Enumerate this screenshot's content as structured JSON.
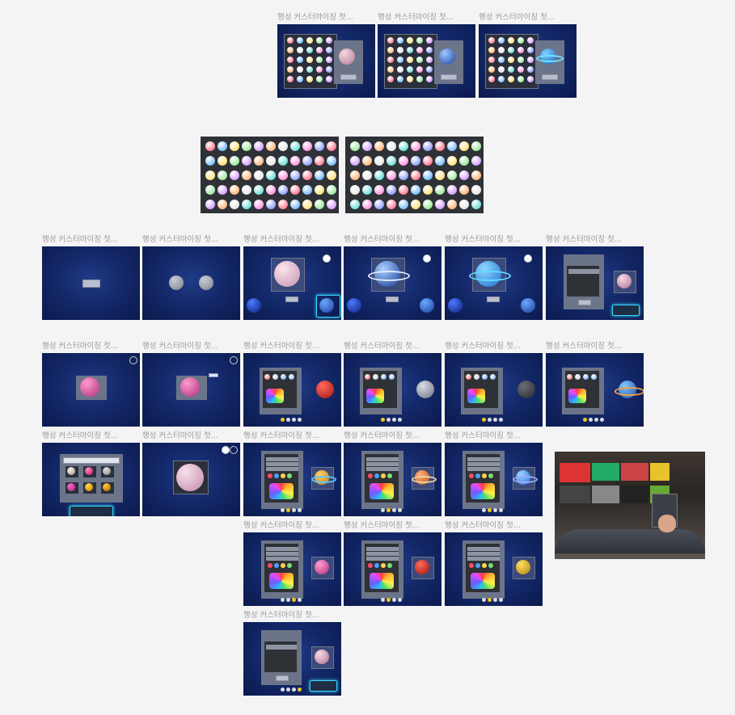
{
  "frame_title": "행성 커스터마이징 첫...",
  "frames": [
    {
      "id": "r1-1",
      "title": "행성 커스터마이징 첫..."
    },
    {
      "id": "r1-2",
      "title": "행성 커스터마이징 첫..."
    },
    {
      "id": "r1-3",
      "title": "행성 커스터마이징 첫..."
    },
    {
      "id": "r3-1",
      "title": "행성 커스터마이징 첫..."
    },
    {
      "id": "r3-2",
      "title": "행성 커스터마이징 첫..."
    },
    {
      "id": "r3-3",
      "title": "행성 커스터마이징 첫..."
    },
    {
      "id": "r3-4",
      "title": "행성 커스터마이징 첫..."
    },
    {
      "id": "r3-5",
      "title": "행성 커스터마이징 첫..."
    },
    {
      "id": "r3-6",
      "title": "행성 커스터마이징 첫..."
    },
    {
      "id": "r4-1",
      "title": "행성 커스터마이징 첫..."
    },
    {
      "id": "r4-2",
      "title": "행성 커스터마이징 첫..."
    },
    {
      "id": "r4-3",
      "title": "행성 커스터마이징 첫..."
    },
    {
      "id": "r4-4",
      "title": "행성 커스터마이징 첫..."
    },
    {
      "id": "r4-5",
      "title": "행성 커스터마이징 첫..."
    },
    {
      "id": "r4-6",
      "title": "행성 커스터마이징 첫..."
    },
    {
      "id": "r5-1",
      "title": "행성 커스터마이징 첫..."
    },
    {
      "id": "r5-2",
      "title": "행성 커스터마이징 첫..."
    },
    {
      "id": "r5-3",
      "title": "행성 커스터마이징 첫..."
    },
    {
      "id": "r5-4",
      "title": "행성 커스터마이징 첫..."
    },
    {
      "id": "r5-5",
      "title": "행성 커스터마이징 첫..."
    },
    {
      "id": "r6-1",
      "title": "행성 커스터마이징 첫..."
    },
    {
      "id": "r6-2",
      "title": "행성 커스터마이징 첫..."
    },
    {
      "id": "r6-3",
      "title": "행성 커스터마이징 첫..."
    },
    {
      "id": "r7-1",
      "title": "행성 커스터마이징 첫..."
    }
  ],
  "colors": {
    "canvas_bg": "#f4f4f5",
    "space_bg": "#14296b",
    "title_text": "#9a9aa0",
    "page_dot_active": "#f2c81a",
    "keyboard_glow": "#38d6ff"
  },
  "asset_sheets": [
    {
      "name": "planet-asset-sheet-1"
    },
    {
      "name": "planet-asset-sheet-2"
    }
  ],
  "reference_photo": {
    "name": "vr-reference-photo"
  }
}
